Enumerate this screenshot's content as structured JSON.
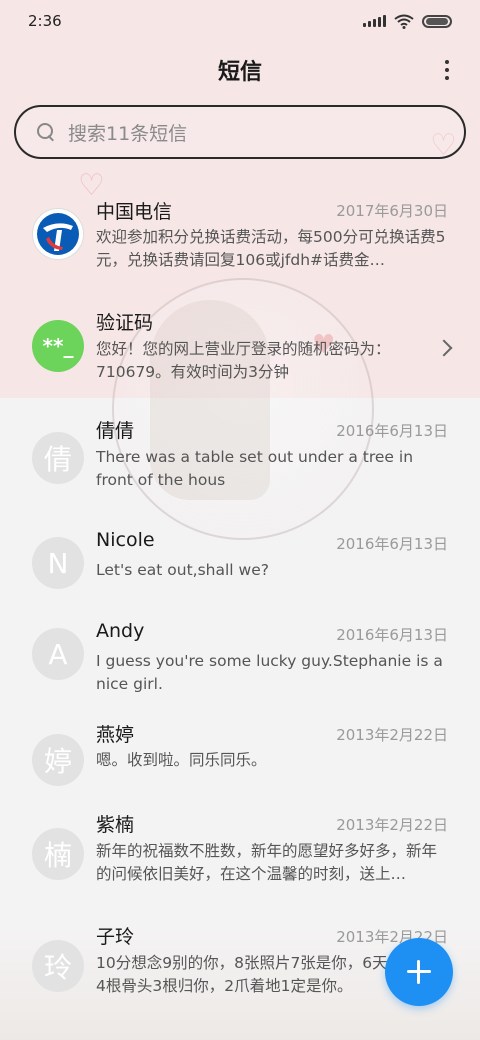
{
  "status_bar": {
    "time": "2:36"
  },
  "header": {
    "title": "短信"
  },
  "search": {
    "placeholder": "搜索11条短信"
  },
  "conversations": [
    {
      "name": "中国电信",
      "date": "2017年6月30日",
      "avatar": "telecom-logo",
      "preview": "欢迎参加积分兑换话费活动，每500分可兑换话费5元，兑换话费请回复106或jfdh#话费金…"
    },
    {
      "name": "验证码",
      "date": "",
      "avatar_text": "**_",
      "preview": "您好！您的网上营业厅登录的随机密码为：710679。有效时间为3分钟"
    },
    {
      "name": "倩倩",
      "date": "2016年6月13日",
      "avatar_text": "倩",
      "preview": "There was a table set out under a tree in front of the hous"
    },
    {
      "name": "Nicole",
      "date": "2016年6月13日",
      "avatar_text": "N",
      "preview": "Let's eat out,shall we?"
    },
    {
      "name": "Andy",
      "date": "2016年6月13日",
      "avatar_text": "A",
      "preview": "I guess you're some lucky guy.Stephanie is a nice girl."
    },
    {
      "name": "燕婷",
      "date": "2013年2月22日",
      "avatar_text": "婷",
      "preview": "嗯。收到啦。同乐同乐。"
    },
    {
      "name": "紫楠",
      "date": "2013年2月22日",
      "avatar_text": "楠",
      "preview": "新年的祝福数不胜数，新年的愿望好多好多，新年的问候依旧美好，在这个温馨的时刻，送上…"
    },
    {
      "name": "子玲",
      "date": "2013年2月22日",
      "avatar_text": "玲",
      "preview": "10分想念9别的你，8张照片7张是你，6天只像你，4根骨头3根归你，2爪着地1定是你。"
    }
  ],
  "colors": {
    "accent": "#1e8ff3",
    "verify_green": "#6cd35b",
    "telecom_blue": "#0a5bb5"
  },
  "icons": {
    "more": "more-vertical-icon",
    "search": "search-icon",
    "compose": "plus-icon",
    "chevron": "chevron-right-icon"
  }
}
